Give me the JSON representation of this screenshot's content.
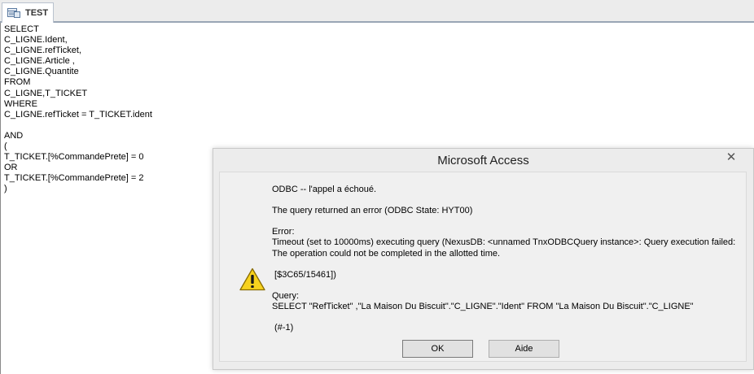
{
  "tab": {
    "label": "TEST",
    "icon": "query-icon"
  },
  "sql_lines": [
    "SELECT",
    "C_LIGNE.Ident,",
    "C_LIGNE.refTicket,",
    "C_LIGNE.Article ,",
    "C_LIGNE.Quantite",
    "FROM",
    "C_LIGNE,T_TICKET",
    "WHERE",
    "C_LIGNE.refTicket = T_TICKET.ident",
    "",
    "AND",
    "(",
    "T_TICKET.[%CommandePrete] = 0",
    "OR",
    "T_TICKET.[%CommandePrete] = 2",
    ")"
  ],
  "dialog": {
    "title": "Microsoft Access",
    "close_glyph": "✕",
    "icon": "warning-icon",
    "lines": [
      "ODBC -- l'appel a échoué.",
      "",
      "The query returned an error (ODBC State: HYT00)",
      "",
      "Error:",
      "Timeout (set to 10000ms) executing query (NexusDB: <unnamed TnxODBCQuery instance>: Query execution failed:",
      "The operation could not be completed in the allotted time.",
      "",
      " [$3C65/15461])",
      "",
      "Query:",
      "SELECT \"RefTicket\" ,\"La Maison Du Biscuit\".\"C_LIGNE\".\"Ident\" FROM \"La Maison Du Biscuit\".\"C_LIGNE\"",
      "",
      " (#-1)"
    ],
    "ok_label": "OK",
    "help_label": "Aide"
  },
  "colors": {
    "warning_fill": "#f7d21e",
    "warning_stroke": "#8a6d00",
    "dialog_bg": "#ececec",
    "button_bg": "#e1e1e1"
  }
}
